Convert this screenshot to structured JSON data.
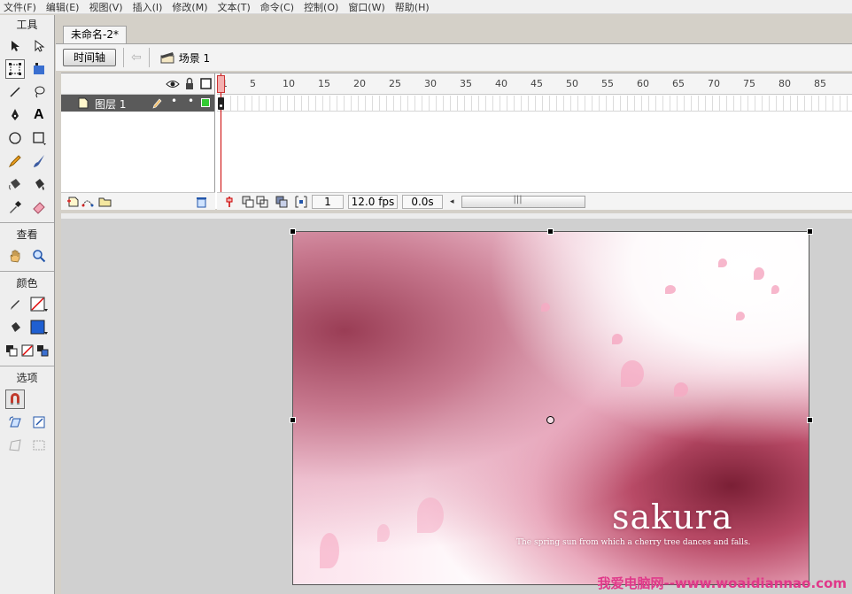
{
  "menu": [
    "文件(F)",
    "编辑(E)",
    "视图(V)",
    "插入(I)",
    "修改(M)",
    "文本(T)",
    "命令(C)",
    "控制(O)",
    "窗口(W)",
    "帮助(H)"
  ],
  "tools": {
    "title": "工具",
    "view_title": "查看",
    "color_title": "颜色",
    "options_title": "选项"
  },
  "document": {
    "tab_title": "未命名-2*",
    "timeline_button": "时间轴",
    "scene_label": "场景 1"
  },
  "timeline": {
    "ruler": [
      "1",
      "5",
      "10",
      "15",
      "20",
      "25",
      "30",
      "35",
      "40",
      "45",
      "50",
      "55",
      "60",
      "65",
      "70",
      "75",
      "80",
      "85"
    ],
    "layer_name": "图层 1",
    "current_frame": "1",
    "fps": "12.0 fps",
    "elapsed": "0.0s"
  },
  "stage": {
    "logo_text": "sakura",
    "caption": "The spring sun from which a cherry tree dances and falls."
  },
  "watermark": "我爱电脑网--www.woaidiannao.com",
  "colors": {
    "stroke": "#000000",
    "fill": "#1f5fd1",
    "layer_row": "#5a5a5a",
    "layer_swatch": "#33cc33",
    "watermark": "#e0398a"
  }
}
